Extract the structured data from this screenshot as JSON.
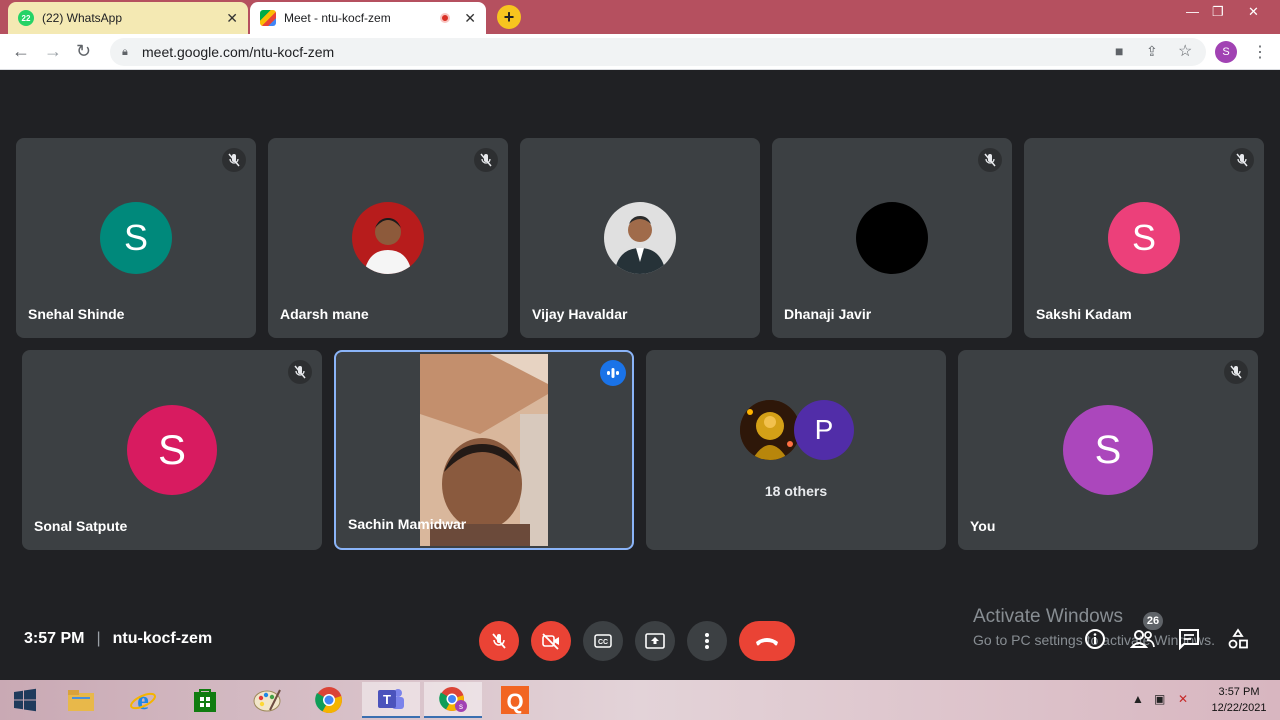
{
  "browser": {
    "tabs": [
      {
        "title": "(22) WhatsApp",
        "badge": "22"
      },
      {
        "title": "Meet - ntu-kocf-zem"
      }
    ],
    "url": "meet.google.com/ntu-kocf-zem",
    "profile_initial": "S"
  },
  "tiles_row1": [
    {
      "name": "Snehal Shinde",
      "initial": "S",
      "color": "#00897b",
      "muted": true
    },
    {
      "name": "Adarsh mane",
      "initial": "",
      "color": "#b71c1c",
      "muted": true
    },
    {
      "name": "Vijay Havaldar",
      "initial": "",
      "color": "#e0e0e0",
      "muted": false
    },
    {
      "name": "Dhanaji Javir",
      "initial": "",
      "color": "#000000",
      "muted": true
    },
    {
      "name": "Sakshi Kadam",
      "initial": "S",
      "color": "#ec407a",
      "muted": true
    }
  ],
  "tiles_row2": {
    "sonal": {
      "name": "Sonal Satpute",
      "initial": "S",
      "color": "#d81b60"
    },
    "sachin": {
      "name": "Sachin Mamidwar"
    },
    "others": {
      "label": "18 others",
      "initial": "P",
      "color": "#512da8"
    },
    "you": {
      "name": "You",
      "initial": "S",
      "color": "#ab47bc"
    }
  },
  "meeting": {
    "time": "3:57 PM",
    "code": "ntu-kocf-zem",
    "participants_count": "26"
  },
  "watermark": {
    "line1": "Activate Windows",
    "line2": "Go to PC settings to activate Windows."
  },
  "taskbar": {
    "time": "3:57 PM",
    "date": "12/22/2021"
  }
}
